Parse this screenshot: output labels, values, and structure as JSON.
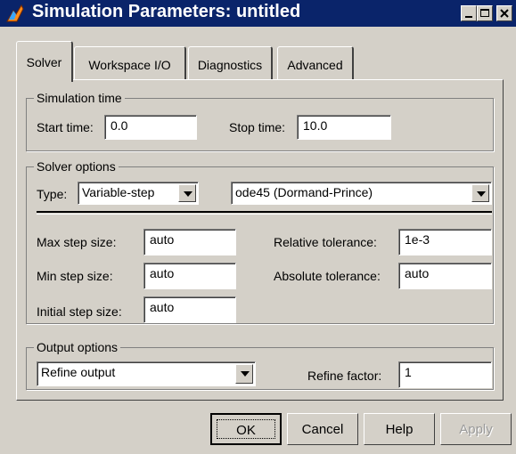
{
  "window": {
    "title": "Simulation Parameters: untitled",
    "controls": [
      "minimize-icon",
      "maximize-icon",
      "close-icon"
    ]
  },
  "tabs": [
    {
      "label": "Solver",
      "active": true
    },
    {
      "label": "Workspace I/O",
      "active": false
    },
    {
      "label": "Diagnostics",
      "active": false
    },
    {
      "label": "Advanced",
      "active": false
    }
  ],
  "simulation_time": {
    "legend": "Simulation time",
    "start_label": "Start time:",
    "start_value": "0.0",
    "stop_label": "Stop time:",
    "stop_value": "10.0"
  },
  "solver_options": {
    "legend": "Solver options",
    "type_label": "Type:",
    "type_value": "Variable-step",
    "solver_value": "ode45 (Dormand-Prince)",
    "max_step_label": "Max step size:",
    "max_step_value": "auto",
    "min_step_label": "Min step size:",
    "min_step_value": "auto",
    "initial_step_label": "Initial step size:",
    "initial_step_value": "auto",
    "rel_tol_label": "Relative tolerance:",
    "rel_tol_value": "1e-3",
    "abs_tol_label": "Absolute tolerance:",
    "abs_tol_value": "auto"
  },
  "output_options": {
    "legend": "Output options",
    "output_value": "Refine output",
    "refine_label": "Refine factor:",
    "refine_value": "1"
  },
  "buttons": {
    "ok": "OK",
    "cancel": "Cancel",
    "help": "Help",
    "apply": "Apply"
  },
  "colors": {
    "titlebar": "#0a246a",
    "face": "#d4d0c8"
  }
}
